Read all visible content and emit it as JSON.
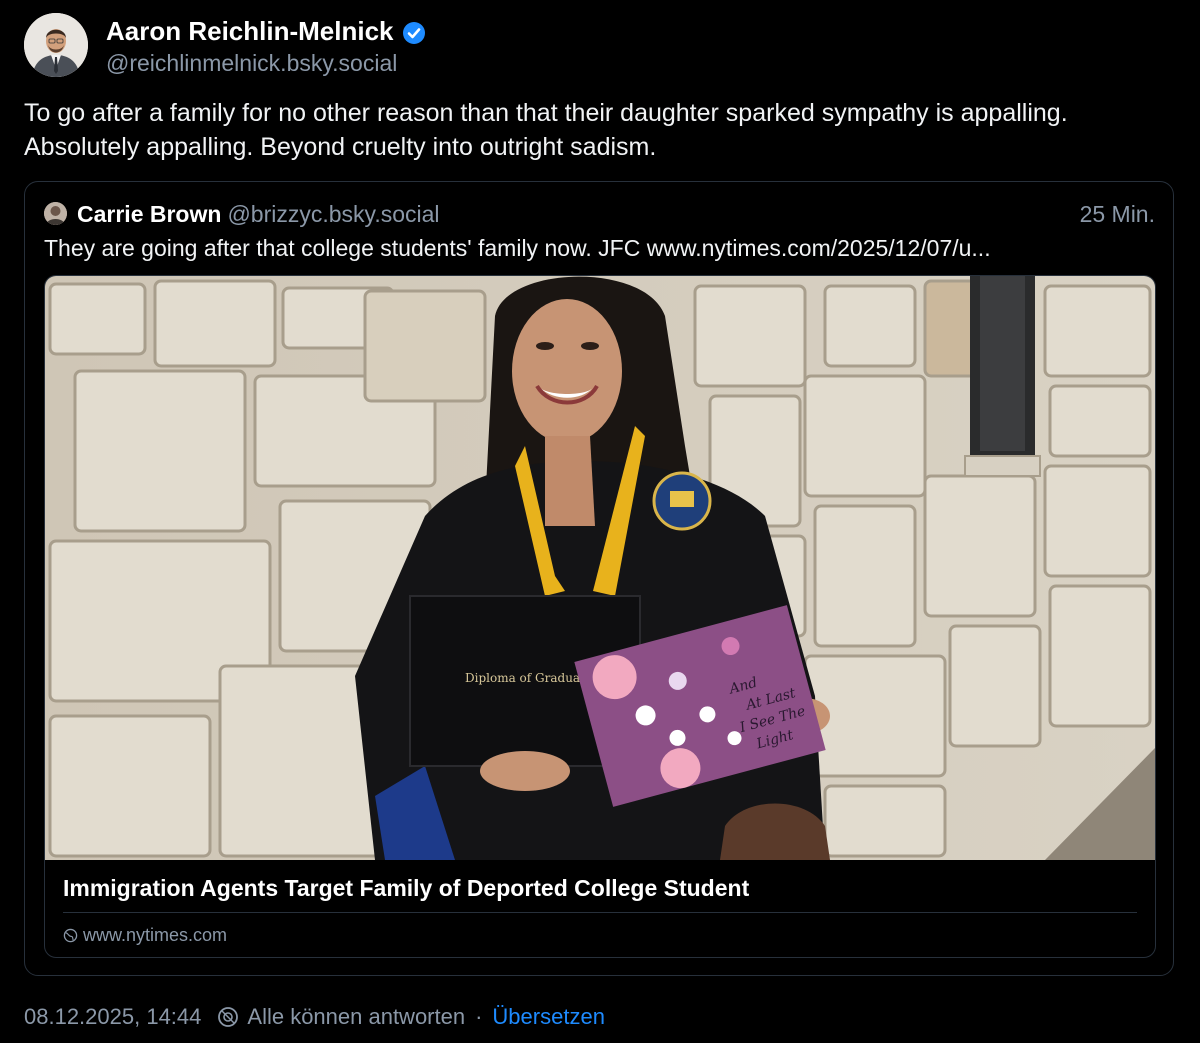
{
  "post": {
    "author": {
      "display_name": "Aaron Reichlin-Melnick",
      "handle": "@reichlinmelnick.bsky.social",
      "verified": true
    },
    "text": "To go after a family for no other reason than that their daughter sparked sympathy is appalling. Absolutely appalling. Beyond cruelty into outright sadism.",
    "quote": {
      "author_name": "Carrie Brown",
      "author_handle": "@brizzyc.bsky.social",
      "time": "25 Min.",
      "text": "They are going after that college students' family now. JFC www.nytimes.com/2025/12/07/u...",
      "card": {
        "image": {
          "diploma_text": "Diploma of Graduation",
          "cap_text": [
            "And",
            "At Last",
            "I See The",
            "Light"
          ]
        },
        "title": "Immigration Agents Target Family of Deported College Student",
        "domain": "www.nytimes.com"
      }
    },
    "footer": {
      "timestamp": "08.12.2025, 14:44",
      "reply_setting": "Alle können antworten",
      "separator": "·",
      "translate_link": "Übersetzen"
    }
  },
  "colors": {
    "background": "#000000",
    "secondary_text": "#8b98a8",
    "link": "#1e8bff",
    "verified_badge": "#1e8bff",
    "border": "#27303b"
  }
}
